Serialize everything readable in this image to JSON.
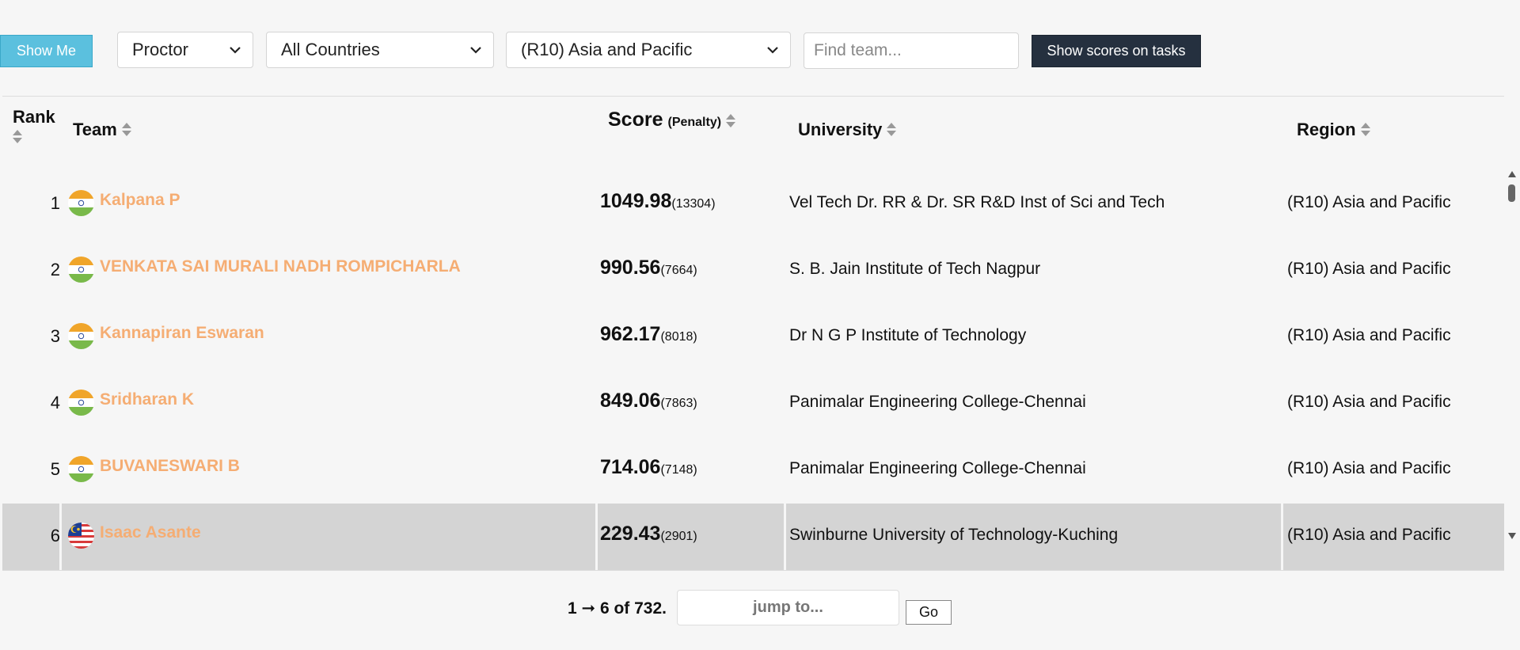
{
  "toolbar": {
    "show_me_label": "Show Me",
    "role_select": "Proctor",
    "country_select": "All Countries",
    "region_select": "(R10) Asia and Pacific",
    "find_placeholder": "Find team...",
    "show_scores_label": "Show scores on tasks"
  },
  "table": {
    "headers": {
      "rank": "Rank",
      "team": "Team",
      "score": "Score",
      "penalty": "(Penalty)",
      "university": "University",
      "region": "Region"
    },
    "rows": [
      {
        "rank": "1",
        "flag": "india-flag-icon",
        "team": "Kalpana P",
        "score": "1049.98",
        "penalty": "(13304)",
        "university": "Vel Tech Dr. RR & Dr. SR R&D Inst of Sci and Tech",
        "region": "(R10) Asia and Pacific"
      },
      {
        "rank": "2",
        "flag": "india-flag-icon",
        "team": "VENKATA SAI MURALI NADH ROMPICHARLA",
        "score": "990.56",
        "penalty": "(7664)",
        "university": "S. B. Jain Institute of Tech Nagpur",
        "region": "(R10) Asia and Pacific"
      },
      {
        "rank": "3",
        "flag": "india-flag-icon",
        "team": "Kannapiran Eswaran",
        "score": "962.17",
        "penalty": "(8018)",
        "university": "Dr N G P Institute of Technology",
        "region": "(R10) Asia and Pacific"
      },
      {
        "rank": "4",
        "flag": "india-flag-icon",
        "team": "Sridharan K",
        "score": "849.06",
        "penalty": "(7863)",
        "university": "Panimalar Engineering College-Chennai",
        "region": "(R10) Asia and Pacific"
      },
      {
        "rank": "5",
        "flag": "india-flag-icon",
        "team": "BUVANESWARI B",
        "score": "714.06",
        "penalty": "(7148)",
        "university": "Panimalar Engineering College-Chennai",
        "region": "(R10) Asia and Pacific"
      },
      {
        "rank": "6",
        "flag": "malaysia-flag-icon",
        "team": "Isaac Asante",
        "score": "229.43",
        "penalty": "(2901)",
        "university": "Swinburne University of Technology-Kuching",
        "region": "(R10) Asia and Pacific"
      }
    ]
  },
  "pager": {
    "range_text": "1 ➞ 6 of 732.",
    "jump_placeholder": "jump to...",
    "go_label": "Go"
  },
  "colors": {
    "accent_button": "#5bc0de",
    "dark_button": "#25303f",
    "team_link": "#f5ad73",
    "highlight_row": "#d4d4d4"
  }
}
